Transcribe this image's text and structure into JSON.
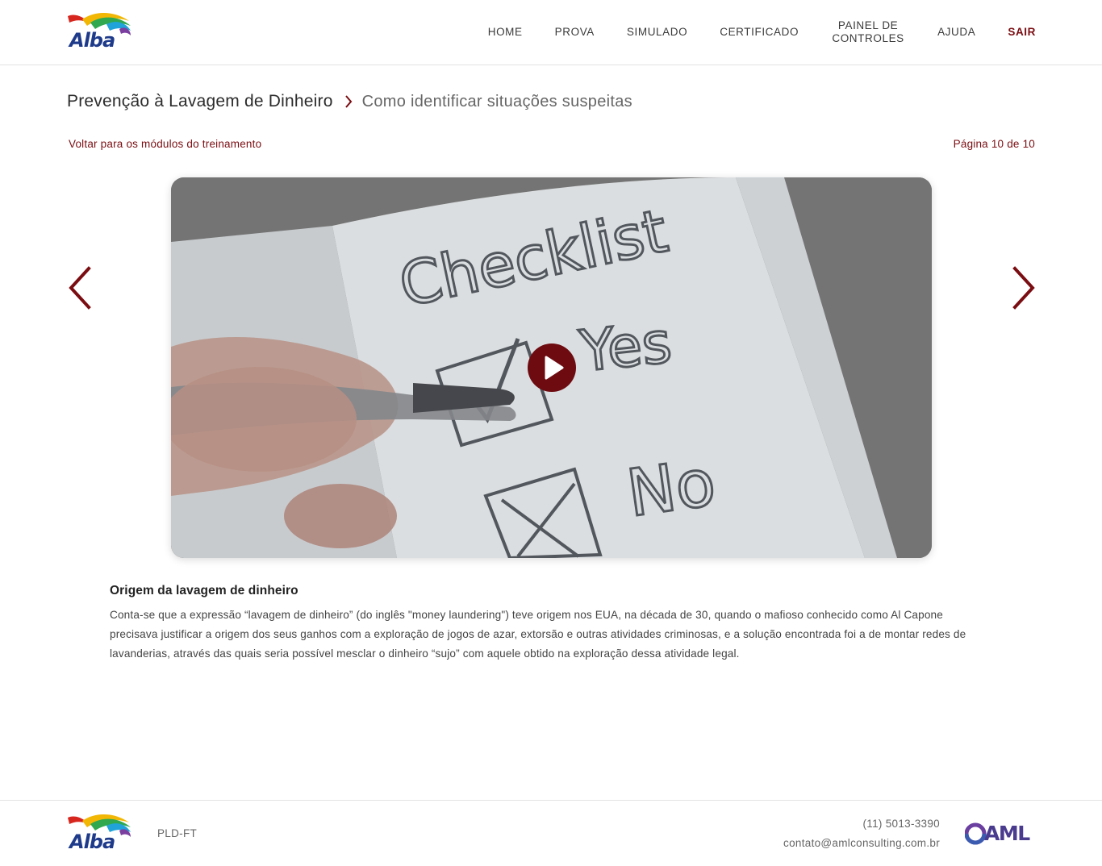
{
  "header": {
    "logo_text": "Alba",
    "nav": {
      "home": "HOME",
      "prova": "PROVA",
      "simulado": "SIMULADO",
      "certificado": "CERTIFICADO",
      "painel_line1": "PAINEL DE",
      "painel_line2": "CONTROLES",
      "ajuda": "AJUDA",
      "sair": "SAIR"
    }
  },
  "breadcrumb": {
    "course": "Prevenção à Lavagem de Dinheiro",
    "module": "Como identificar situações suspeitas"
  },
  "navigation": {
    "back_link": "Voltar para os módulos do treinamento",
    "page_indicator": "Página 10 de 10"
  },
  "video": {
    "thumbnail_texts": {
      "heading": "Checklist",
      "option_yes": "Yes",
      "option_no": "No"
    },
    "play_icon": "play-icon"
  },
  "content": {
    "title": "Origem da lavagem de dinheiro",
    "body": "Conta-se que a expressão “lavagem de dinheiro” (do inglês \"money laundering\") teve origem nos EUA, na década de 30, quando o mafioso conhecido como Al Capone precisava justificar a origem dos seus ganhos com a exploração de jogos de azar, extorsão e outras atividades criminosas, e a solução encontrada foi a de montar redes de lavanderias, através das quais seria possível mesclar o dinheiro “sujo” com aquele obtido na exploração dessa atividade legal."
  },
  "footer": {
    "logo_text": "Alba",
    "tag": "PLD-FT",
    "phone": "(11) 5013-3390",
    "email": "contato@amlconsulting.com.br",
    "partner_logo_text": "AML"
  },
  "colors": {
    "accent": "#7a0d12",
    "play_button": "#6d0b10",
    "overlay": "#7d7d7d"
  }
}
